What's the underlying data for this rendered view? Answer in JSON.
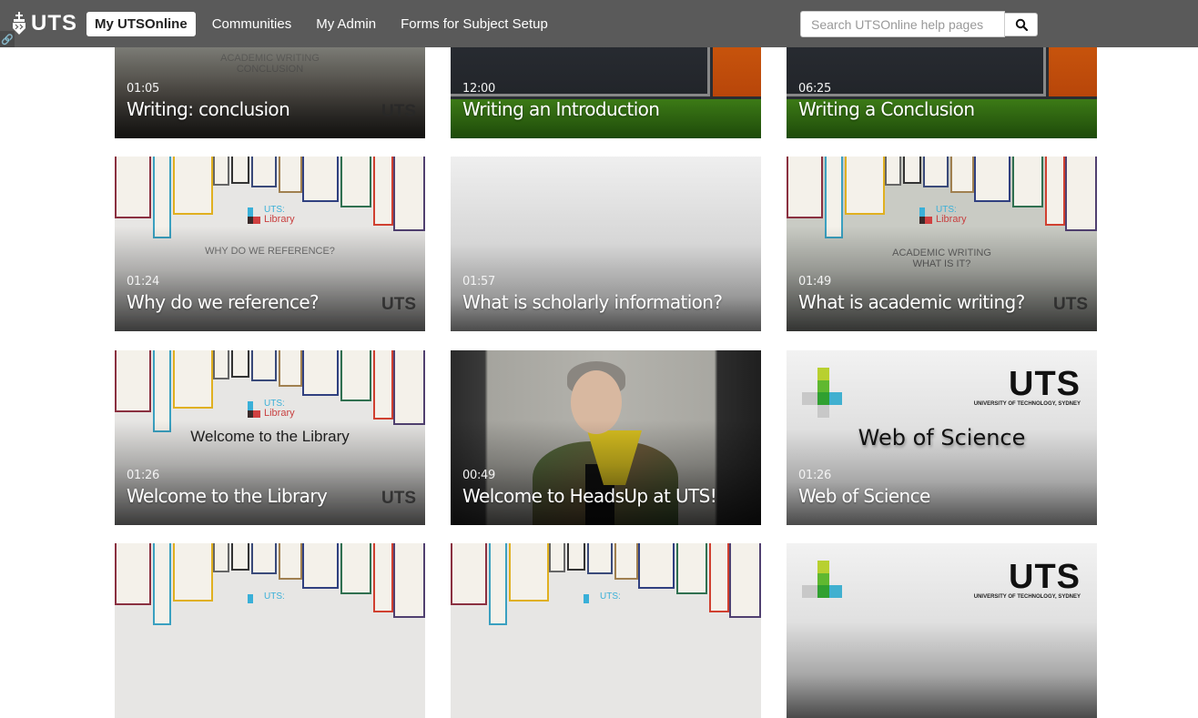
{
  "header": {
    "logo_text": "UTS",
    "nav": [
      {
        "label": "My UTSOnline",
        "active": true
      },
      {
        "label": "Communities",
        "active": false
      },
      {
        "label": "My Admin",
        "active": false
      },
      {
        "label": "Forms for Subject Setup",
        "active": false
      }
    ],
    "search": {
      "placeholder": "Search UTSOnline help pages",
      "value": "",
      "button_icon": "search-icon"
    },
    "link_badge_icon": "link-icon"
  },
  "videos": [
    {
      "duration": "01:05",
      "title": "Writing: conclusion",
      "thumb_text": [
        "ACADEMIC WRITING",
        "CONCLUSION"
      ],
      "watermark": "UTS"
    },
    {
      "duration": "12:00",
      "title": "Writing an Introduction"
    },
    {
      "duration": "06:25",
      "title": "Writing a Conclusion"
    },
    {
      "duration": "01:24",
      "title": "Why do we reference?",
      "thumb_text": [
        "WHY DO WE REFERENCE?"
      ],
      "thumb_logo": [
        "UTS:",
        "Library"
      ],
      "watermark": "UTS"
    },
    {
      "duration": "01:57",
      "title": "What is scholarly information?"
    },
    {
      "duration": "01:49",
      "title": "What is academic writing?",
      "thumb_text": [
        "ACADEMIC WRITING",
        "WHAT IS IT?"
      ],
      "thumb_logo": [
        "UTS:",
        "Library"
      ],
      "watermark": "UTS"
    },
    {
      "duration": "01:26",
      "title": "Welcome to the Library",
      "thumb_text": [
        "Welcome to the Library"
      ],
      "thumb_logo": [
        "UTS:",
        "Library"
      ],
      "watermark": "UTS"
    },
    {
      "duration": "00:49",
      "title": "Welcome to HeadsUp at UTS!"
    },
    {
      "duration": "01:26",
      "title": "Web of Science",
      "thumb_text": [
        "Web of Science"
      ],
      "thumb_brand": [
        "UTS",
        "UNIVERSITY OF TECHNOLOGY, SYDNEY"
      ]
    },
    {
      "thumb_logo": [
        "UTS:"
      ]
    },
    {
      "thumb_logo": [
        "UTS:"
      ]
    },
    {
      "thumb_brand": [
        "UTS",
        "UNIVERSITY OF TECHNOLOGY, SYDNEY"
      ]
    }
  ]
}
